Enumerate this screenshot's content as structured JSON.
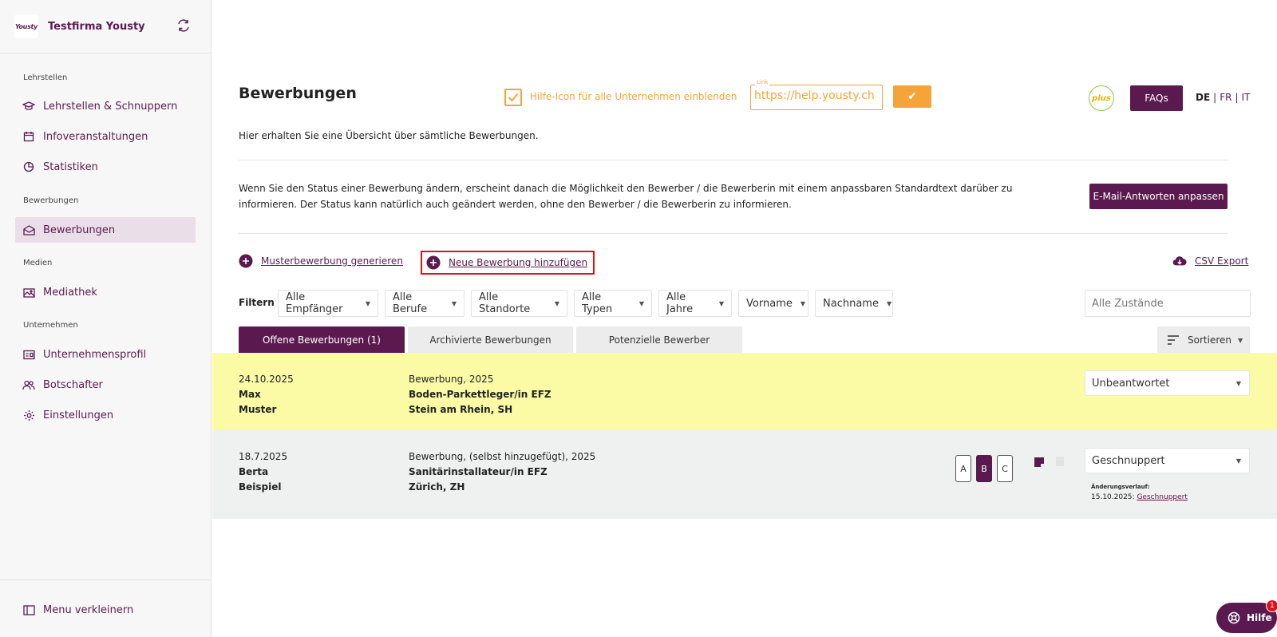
{
  "sidebar": {
    "company": "Testfirma Yousty",
    "logo_text": "Yousty",
    "sections": [
      "Lehrstellen",
      "Bewerbungen",
      "Medien",
      "Unternehmen"
    ],
    "items": [
      {
        "label": "Lehrstellen & Schnuppern",
        "icon": "graduation-cap-icon"
      },
      {
        "label": "Infoveranstaltungen",
        "icon": "calendar-icon"
      },
      {
        "label": "Statistiken",
        "icon": "pie-chart-icon"
      },
      {
        "label": "Bewerbungen",
        "icon": "envelope-icon",
        "active": true
      },
      {
        "label": "Mediathek",
        "icon": "images-icon"
      },
      {
        "label": "Unternehmensprofil",
        "icon": "id-card-icon"
      },
      {
        "label": "Botschafter",
        "icon": "users-icon"
      },
      {
        "label": "Einstellungen",
        "icon": "gear-icon"
      }
    ],
    "collapse_label": "Menu verkleinern"
  },
  "header": {
    "title": "Bewerbungen",
    "hint_label": "Hilfe-Icon für alle Unternehmen einblenden",
    "link_caption": "Link",
    "link_value": "https://help.yousty.ch",
    "confirm_label": "✔",
    "plus_label": "plus",
    "faqs_label": "FAQs",
    "languages": [
      "DE",
      "FR",
      "IT"
    ]
  },
  "subtitle": "Hier erhalten Sie eine Übersicht über sämtliche Bewerbungen.",
  "info_text": "Wenn Sie den Status einer Bewerbung ändern, erscheint danach die Möglichkeit den Bewerber / die Bewerberin mit einem anpassbaren Standardtext darüber zu informieren. Der Status kann natürlich auch geändert werden, ohne den Bewerber / die Bewerberin zu informieren.",
  "email_button": "E-Mail-Antworten anpassen",
  "actions": {
    "muster": "Musterbewerbung generieren",
    "neue": "Neue Bewerbung hinzufügen",
    "csv": "CSV Export"
  },
  "filter": {
    "label": "Filtern",
    "selects": [
      "Alle Empfänger",
      "Alle Berufe",
      "Alle Standorte",
      "Alle Typen",
      "Alle Jahre",
      "Vorname",
      "Nachname"
    ],
    "status_placeholder": "Alle Zustände"
  },
  "tabs": [
    "Offene Bewerbungen (1)",
    "Archivierte Bewerbungen",
    "Potenzielle Bewerber"
  ],
  "sort_label": "Sortieren",
  "rows": [
    {
      "date": "24.10.2025",
      "first": "Max",
      "last": "Muster",
      "type": "Bewerbung, 2025",
      "job": "Boden-Parkettleger/in EFZ",
      "location": "Stein am Rhein, SH",
      "status": "Unbeantwortet"
    },
    {
      "date": "18.7.2025",
      "first": "Berta",
      "last": "Beispiel",
      "type": "Bewerbung, (selbst hinzugefügt), 2025",
      "job": "Sanitärinstallateur/in EFZ",
      "location": "Zürich, ZH",
      "status": "Geschnuppert",
      "ratings": [
        "A",
        "B",
        "C"
      ],
      "selected_rating": "B",
      "history_label": "Änderungsverlauf:",
      "history_date": "15.10.2025:",
      "history_status": "Geschnuppert"
    }
  ],
  "help": {
    "label": "Hilfe",
    "badge": "1"
  },
  "colors": {
    "primary": "#5b1a4f",
    "accent": "#f5a43a",
    "highlight_row": "#fbfba6",
    "alert": "#e1111a"
  }
}
